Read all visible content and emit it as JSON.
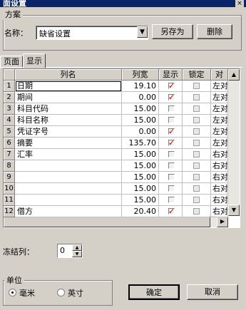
{
  "title_bar": {
    "title": "面设置",
    "close": "×"
  },
  "scheme": {
    "group_label": "方案",
    "name_label": "名称：",
    "name_value": "缺省设置",
    "save_as": "另存为",
    "delete": "删除"
  },
  "tabs": [
    {
      "label": "页面"
    },
    {
      "label": "显示"
    }
  ],
  "grid": {
    "columns": [
      "列名",
      "列宽",
      "显示",
      "锁定",
      "对"
    ],
    "rows": [
      {
        "num": "1",
        "name": "日期",
        "width": "19.10",
        "show": true,
        "align": "左对"
      },
      {
        "num": "2",
        "name": "期间",
        "width": "0.00",
        "show": true,
        "align": "左对"
      },
      {
        "num": "3",
        "name": "科目代码",
        "width": "15.00",
        "show": false,
        "align": "左对"
      },
      {
        "num": "4",
        "name": "科目名称",
        "width": "15.00",
        "show": false,
        "align": "左对"
      },
      {
        "num": "5",
        "name": "凭证字号",
        "width": "0.00",
        "show": true,
        "align": "左对"
      },
      {
        "num": "6",
        "name": "摘要",
        "width": "135.70",
        "show": true,
        "align": "左对"
      },
      {
        "num": "7",
        "name": "汇率",
        "width": "15.00",
        "show": false,
        "align": "右对"
      },
      {
        "num": "8",
        "name": "",
        "width": "15.00",
        "show": false,
        "align": "右对"
      },
      {
        "num": "9",
        "name": "",
        "width": "15.00",
        "show": false,
        "align": "右对"
      },
      {
        "num": "10",
        "name": "",
        "width": "15.00",
        "show": false,
        "align": "右对"
      },
      {
        "num": "11",
        "name": "",
        "width": "15.00",
        "show": false,
        "align": "右对"
      },
      {
        "num": "12",
        "name": "借方",
        "width": "20.40",
        "show": true,
        "align": "右对"
      }
    ]
  },
  "freeze": {
    "label": "冻结列：",
    "value": "0"
  },
  "unit": {
    "group_label": "单位",
    "options": [
      "毫米",
      "英寸"
    ],
    "selected": 0
  },
  "buttons": {
    "ok": "确定",
    "cancel": "取消"
  },
  "icons": {
    "combo": "chevron-down-icon",
    "check": "checkmark-icon"
  },
  "colors": {
    "titlebar": "#0a246a",
    "check": "#c00000",
    "dialog": "#d4d0c8"
  }
}
